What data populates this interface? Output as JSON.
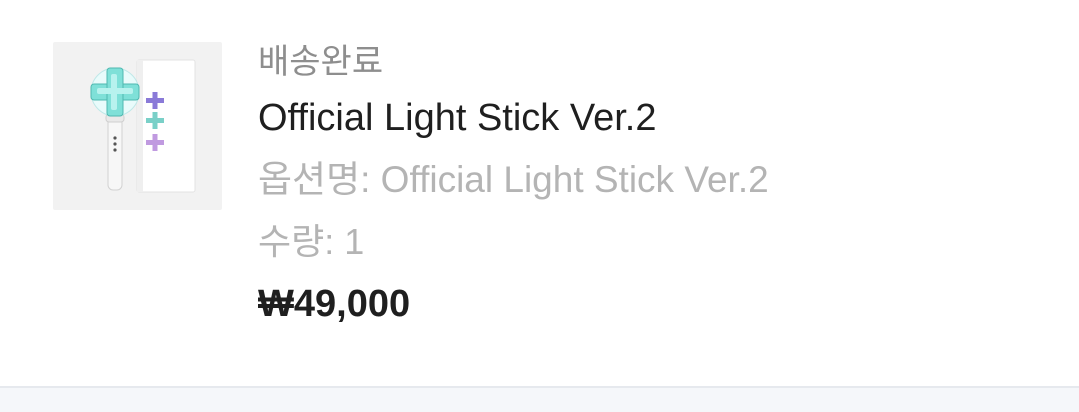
{
  "order_item": {
    "status": "배송완료",
    "product_name": "Official Light Stick Ver.2",
    "option_text": "옵션명: Official Light Stick Ver.2",
    "quantity_text": "수량: 1",
    "price_text": "₩49,000",
    "thumbnail_icon": "light-stick-product-image"
  },
  "colors": {
    "status": "#8e8e8e",
    "product_name": "#1f1f1f",
    "secondary_text": "#b4b4b4",
    "price": "#1f1f1f",
    "thumb_bg": "#f2f2f2",
    "divider": "#e6e9ee",
    "footer_bg": "#f5f7fa"
  }
}
